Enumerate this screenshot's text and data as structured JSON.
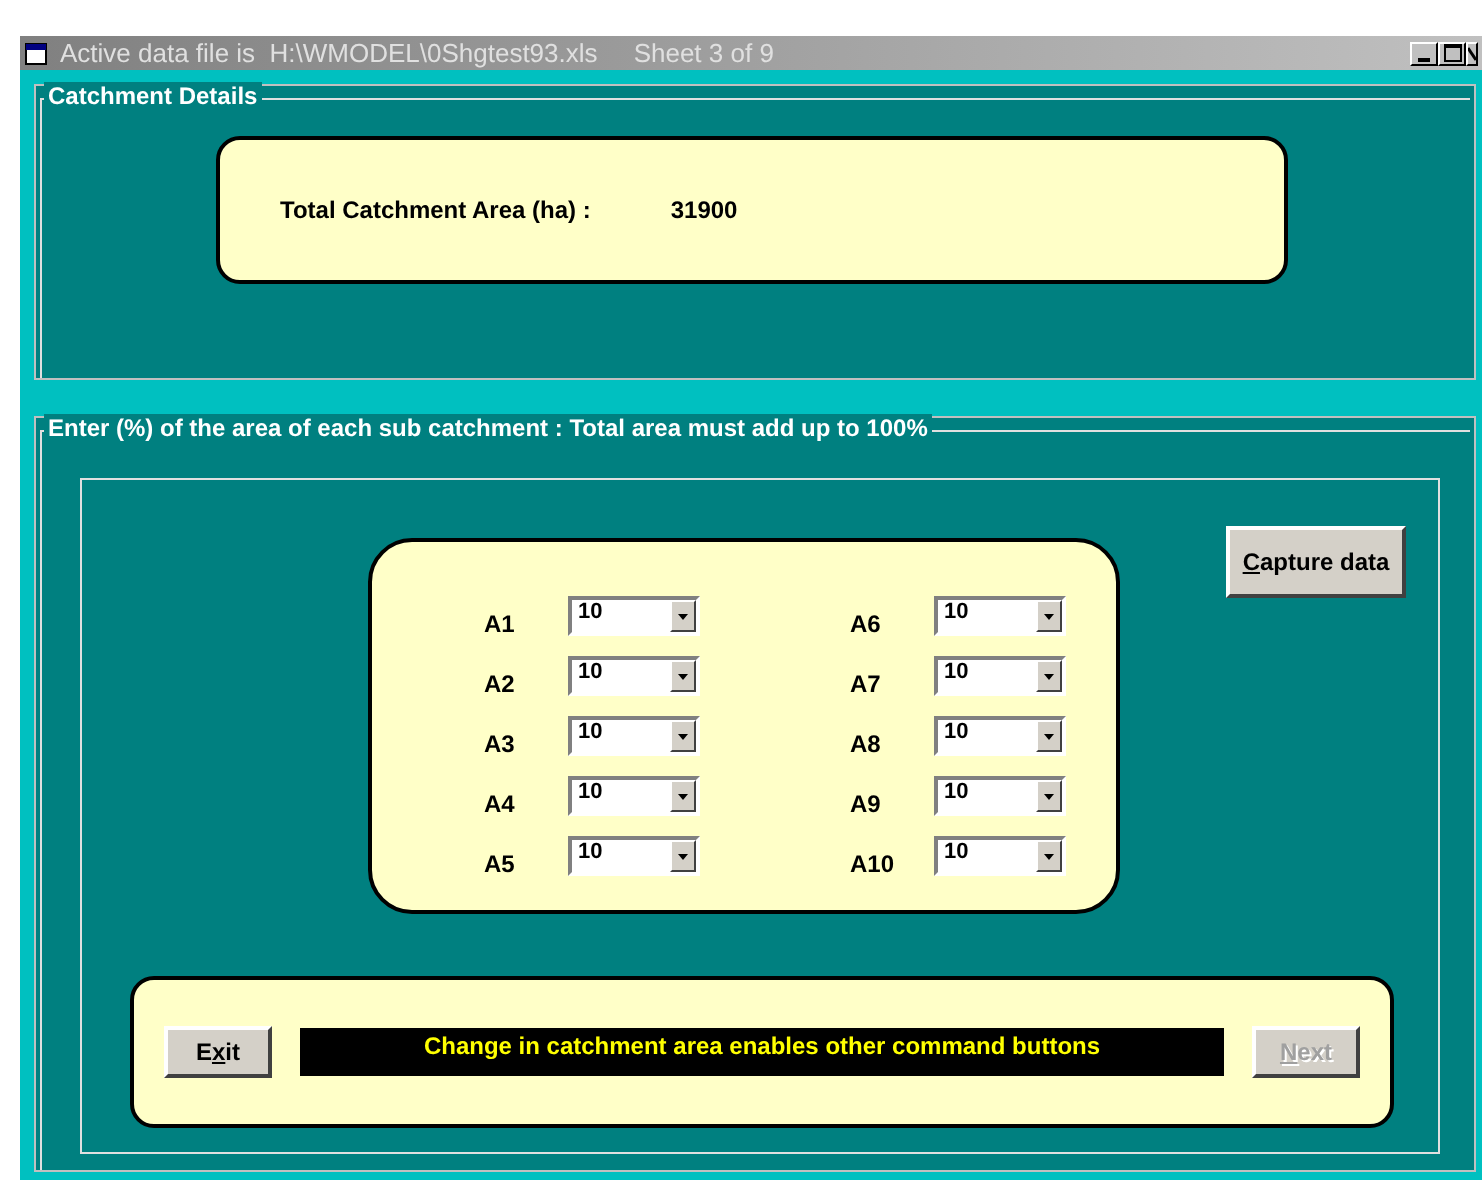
{
  "window": {
    "title": "Active data file is  H:\\WMODEL\\0Shgtest93.xls     Sheet 3 of 9"
  },
  "catchment_details": {
    "legend": "Catchment Details",
    "label": "Total Catchment Area  (ha) :",
    "value": "31900"
  },
  "sub_catchments": {
    "legend": "Enter (%) of  the area of each sub catchment :   Total area must add up to 100%",
    "fields": [
      {
        "label": "A1",
        "value": "10"
      },
      {
        "label": "A2",
        "value": "10"
      },
      {
        "label": "A3",
        "value": "10"
      },
      {
        "label": "A4",
        "value": "10"
      },
      {
        "label": "A5",
        "value": "10"
      },
      {
        "label": "A6",
        "value": "10"
      },
      {
        "label": "A7",
        "value": "10"
      },
      {
        "label": "A8",
        "value": "10"
      },
      {
        "label": "A9",
        "value": "10"
      },
      {
        "label": "A10",
        "value": "10"
      }
    ],
    "capture_button": {
      "accel": "C",
      "after": "apture data",
      "disabled": false
    }
  },
  "footer": {
    "exit_button": {
      "before": "E",
      "accel": "x",
      "after": "it",
      "disabled": false
    },
    "message": "Change in catchment area enables other command buttons",
    "next_button": {
      "accel": "N",
      "after": "ext",
      "disabled": true
    }
  }
}
